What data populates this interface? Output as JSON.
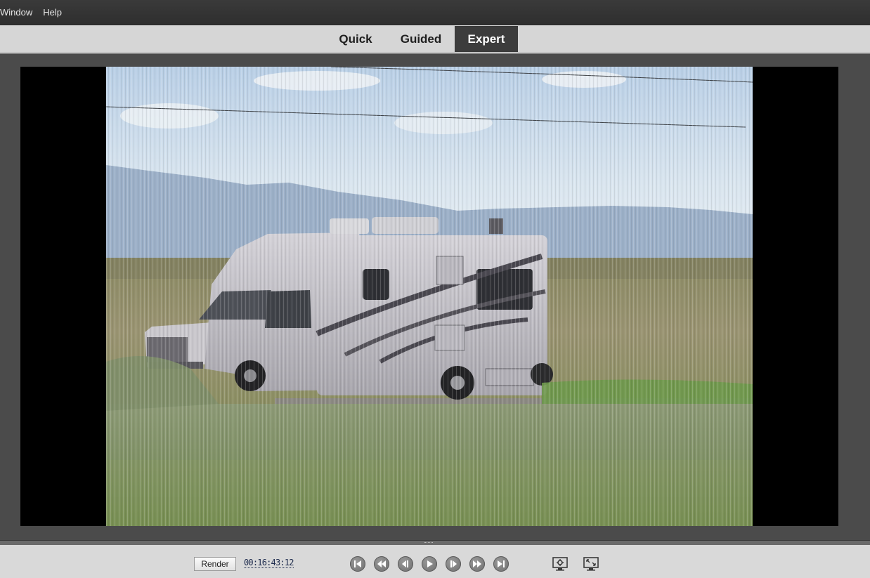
{
  "menu": {
    "items": [
      "Window",
      "Help"
    ]
  },
  "modes": {
    "quick": "Quick",
    "guided": "Guided",
    "expert": "Expert",
    "active": "expert"
  },
  "controls": {
    "render_label": "Render",
    "timecode": "00:16:43:12",
    "icons": [
      "go-to-start-icon",
      "rewind-icon",
      "step-back-icon",
      "play-icon",
      "step-forward-icon",
      "fast-forward-icon",
      "go-to-end-icon",
      "monitor-settings-icon",
      "fullscreen-icon"
    ]
  },
  "colors": {
    "menubar": "#2e2e2e",
    "modebar": "#d6d6d6",
    "active_tab": "#3c3c3c",
    "panel": "#4b4b4b"
  }
}
